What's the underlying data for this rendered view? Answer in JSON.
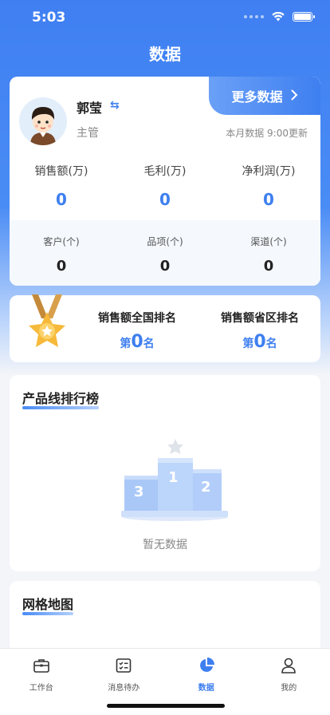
{
  "status": {
    "time": "5:03"
  },
  "page": {
    "title": "数据"
  },
  "profile": {
    "name": "郭莹",
    "role": "主管",
    "more_label": "更多数据",
    "update_text": "本月数据 9:00更新"
  },
  "stats_main": [
    {
      "label": "销售额(万)",
      "value": "0"
    },
    {
      "label": "毛利(万)",
      "value": "0"
    },
    {
      "label": "净利润(万)",
      "value": "0"
    }
  ],
  "stats_secondary": [
    {
      "label": "客户(个)",
      "value": "0"
    },
    {
      "label": "品项(个)",
      "value": "0"
    },
    {
      "label": "渠道(个)",
      "value": "0"
    }
  ],
  "ranking": {
    "national_title": "销售额全国排名",
    "province_title": "销售额省区排名",
    "prefix": "第",
    "suffix": "名",
    "national_value": "0",
    "province_value": "0"
  },
  "product_line": {
    "title": "产品线排行榜",
    "empty_text": "暂无数据"
  },
  "grid_map": {
    "title": "网格地图"
  },
  "tabbar": {
    "items": [
      {
        "label": "工作台",
        "icon": "briefcase-icon"
      },
      {
        "label": "消息待办",
        "icon": "checklist-icon"
      },
      {
        "label": "数据",
        "icon": "pie-chart-icon"
      },
      {
        "label": "我的",
        "icon": "person-icon"
      }
    ]
  },
  "colors": {
    "accent": "#3e7ff0",
    "header_bg": "#3f7ff2"
  }
}
